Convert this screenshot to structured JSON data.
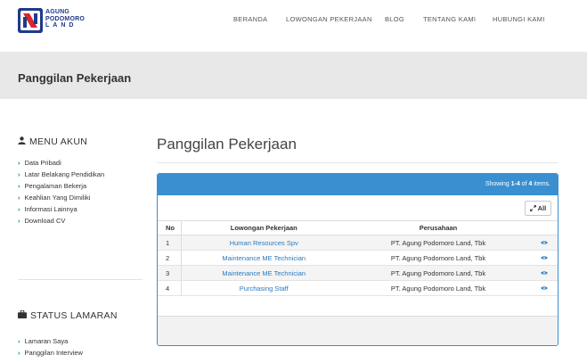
{
  "brand": {
    "line1": "AGUNG",
    "line2": "PODOMORO",
    "line3": "LAND"
  },
  "nav": [
    "BERANDA",
    "LOWONGAN PEKERJAAN",
    "BLOG",
    "TENTANG KAMI",
    "HUBUNGI KAMI"
  ],
  "banner": {
    "title": "Panggilan Pekerjaan"
  },
  "sidebar": {
    "menu_heading": "MENU AKUN",
    "menu_items": [
      "Data Pribadi",
      "Latar Belakang Pendidikan",
      "Pengalaman Bekerja",
      "Keahlian Yang Dimiliki",
      "Informasi Lainnya",
      "Download CV"
    ],
    "status_heading": "STATUS LAMARAN",
    "status_items": [
      "Lamaran Saya",
      "Panggilan Interview"
    ]
  },
  "main": {
    "title": "Panggilan Pekerjaan",
    "summary": {
      "prefix": "Showing ",
      "range": "1-4",
      "of": " of ",
      "total": "4",
      "suffix": " items."
    },
    "all_button": "All",
    "columns": {
      "no": "No",
      "job": "Lowongan Pekerjaan",
      "company": "Perusahaan"
    },
    "rows": [
      {
        "no": "1",
        "job": "Human Resources Spv",
        "company": "PT. Agung Podomoro Land, Tbk"
      },
      {
        "no": "2",
        "job": "Maintenance ME Technician",
        "company": "PT. Agung Podomoro Land, Tbk"
      },
      {
        "no": "3",
        "job": "Maintenance ME Technician",
        "company": "PT. Agung Podomoro Land, Tbk"
      },
      {
        "no": "4",
        "job": "Purchasing Staff",
        "company": "PT. Agung Podomoro Land, Tbk"
      }
    ]
  },
  "colors": {
    "brand_blue": "#1f3a8a",
    "brand_red": "#d7262e",
    "panel_blue": "#3a8fd0",
    "link_blue": "#2a7ac0",
    "chevron_green": "#0a8f4a"
  },
  "icons": {
    "logo": "agung-podomoro-logo",
    "user": "user-icon",
    "briefcase": "briefcase-icon",
    "expand": "expand-arrows-icon",
    "view": "eye-icon"
  }
}
